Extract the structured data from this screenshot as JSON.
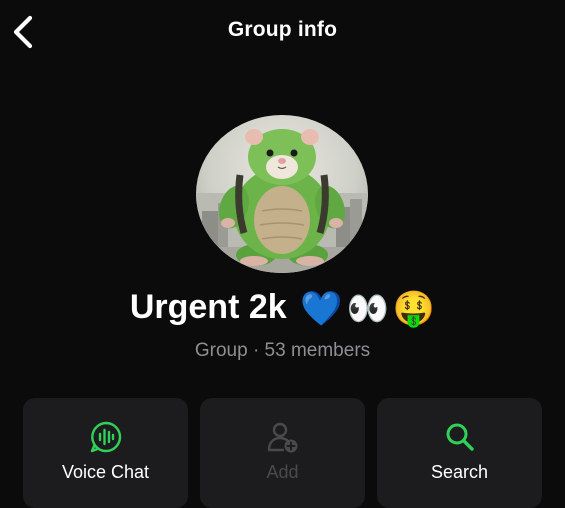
{
  "header": {
    "back_icon": "chevron-left-icon",
    "title": "Group info"
  },
  "group": {
    "avatar_description_icon": "green-hamster-avatar",
    "name": "Urgent 2k",
    "name_emojis": [
      "💙",
      "👀",
      "🤑"
    ],
    "type": "Group",
    "separator": "·",
    "members": "53 members"
  },
  "actions": [
    {
      "label": "Voice Chat",
      "icon": "voice-chat-icon",
      "enabled": true
    },
    {
      "label": "Add",
      "icon": "add-person-icon",
      "enabled": false
    },
    {
      "label": "Search",
      "icon": "search-icon",
      "enabled": true
    }
  ],
  "colors": {
    "background": "#0b0b0b",
    "card": "#1c1c1e",
    "accent": "#30d158",
    "muted": "#8e8e93",
    "disabled": "#4a4a4d"
  }
}
